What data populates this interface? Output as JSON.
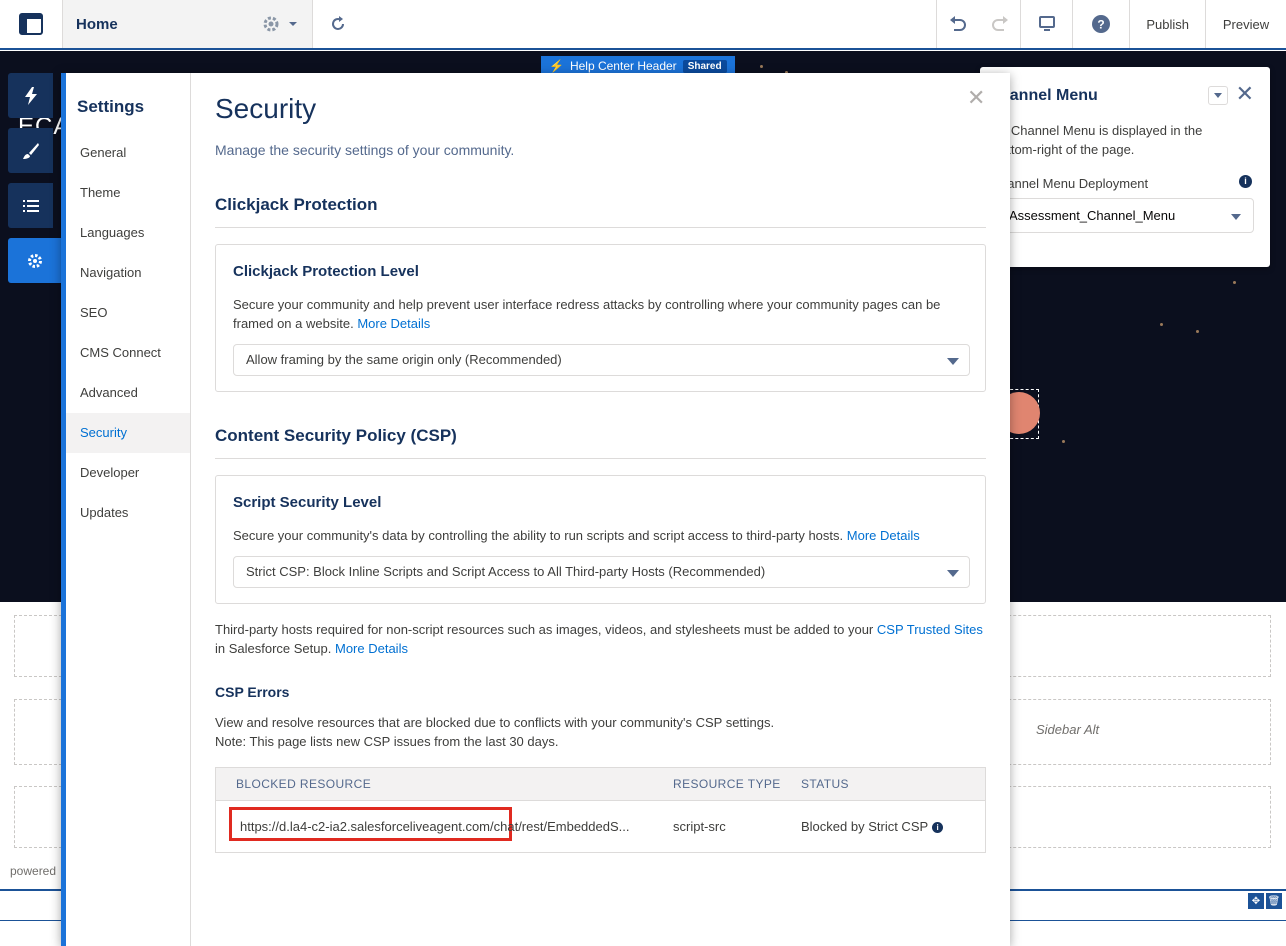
{
  "toolbar": {
    "page_title": "Home",
    "publish_label": "Publish",
    "preview_label": "Preview",
    "icons": [
      "app-layout-icon",
      "gear-icon",
      "chevron-down-icon",
      "refresh-icon",
      "undo-icon",
      "redo-icon",
      "desktop-icon",
      "help-icon"
    ]
  },
  "canvas": {
    "header_component": "Help Center Header",
    "shared_badge": "Shared",
    "brand_fragment": "ECA",
    "sidebar_alt_label": "Sidebar Alt",
    "powered_text": "powered"
  },
  "dock": {
    "icons": [
      "lightning-icon",
      "brush-icon",
      "list-icon",
      "gear-icon"
    ],
    "active": "gear-icon"
  },
  "channel_menu": {
    "title": "hannel Menu",
    "description": "e Channel Menu is displayed in the ottom-right of the page.",
    "deployment_label": "hannel Menu Deployment",
    "deployment_value": "Assessment_Channel_Menu"
  },
  "settings": {
    "nav_title": "Settings",
    "nav_items": [
      "General",
      "Theme",
      "Languages",
      "Navigation",
      "SEO",
      "CMS Connect",
      "Advanced",
      "Security",
      "Developer",
      "Updates"
    ],
    "active_item": "Security"
  },
  "security": {
    "title": "Security",
    "subtitle": "Manage the security settings of your community.",
    "clickjack": {
      "section_title": "Clickjack Protection",
      "card_title": "Clickjack Protection Level",
      "description": "Secure your community and help prevent user interface redress attacks by controlling where your community pages can be framed on a website.",
      "more_details": "More Details",
      "selected_option": "Allow framing by the same origin only (Recommended)"
    },
    "csp": {
      "section_title": "Content Security Policy (CSP)",
      "card_title": "Script Security Level",
      "description": "Secure your community's data by controlling the ability to run scripts and script access to third-party hosts.",
      "more_details": "More Details",
      "selected_option": "Strict CSP: Block Inline Scripts and Script Access to All Third-party Hosts (Recommended)",
      "note_prefix": "Third-party hosts required for non-script resources such as images, videos, and stylesheets must be added to your",
      "note_link": "CSP Trusted Sites",
      "note_suffix": "in Salesforce Setup.",
      "note_more_details": "More Details"
    },
    "csp_errors": {
      "title": "CSP Errors",
      "description_line1": "View and resolve resources that are blocked due to conflicts with your community's CSP settings.",
      "description_line2": "Note: This page lists new CSP issues from the last 30 days.",
      "columns": [
        "BLOCKED RESOURCE",
        "RESOURCE TYPE",
        "STATUS"
      ],
      "rows": [
        {
          "resource": "https://d.la4-c2-ia2.salesforceliveagent.com/chat/rest/EmbeddedS...",
          "type": "script-src",
          "status": "Blocked by Strict CSP"
        }
      ]
    }
  },
  "colors": {
    "accent": "#1b73d9",
    "brand_dark": "#16325c",
    "link": "#0070d2",
    "highlight": "#e02a20"
  }
}
